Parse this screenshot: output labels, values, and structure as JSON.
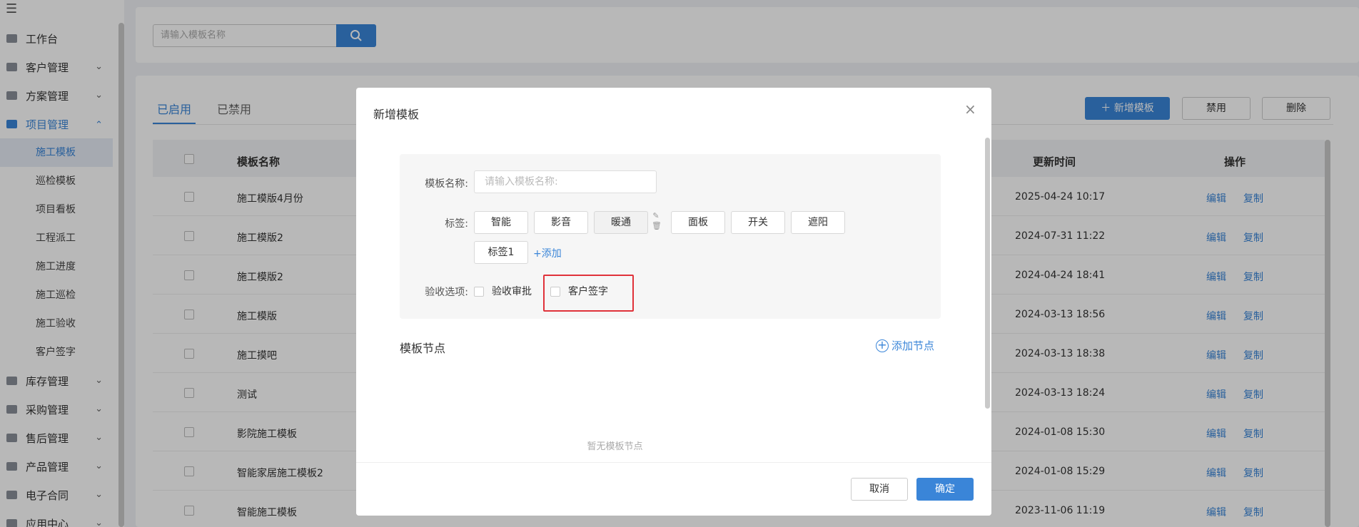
{
  "sidebar": {
    "items": [
      {
        "label": "工作台",
        "icon": "workbench-icon",
        "expandable": false
      },
      {
        "label": "客户管理",
        "icon": "customer-icon",
        "expandable": true
      },
      {
        "label": "方案管理",
        "icon": "plan-icon",
        "expandable": true
      },
      {
        "label": "项目管理",
        "icon": "folder-icon",
        "expandable": true,
        "expanded": true
      },
      {
        "label": "库存管理",
        "icon": "inventory-icon",
        "expandable": true
      },
      {
        "label": "采购管理",
        "icon": "cart-icon",
        "expandable": true
      },
      {
        "label": "售后管理",
        "icon": "headset-icon",
        "expandable": true
      },
      {
        "label": "产品管理",
        "icon": "product-icon",
        "expandable": true
      },
      {
        "label": "电子合同",
        "icon": "contract-icon",
        "expandable": true
      },
      {
        "label": "应用中心",
        "icon": "apps-icon",
        "expandable": true
      }
    ],
    "project_sub": [
      "施工模板",
      "巡检模板",
      "项目看板",
      "工程派工",
      "施工进度",
      "施工巡检",
      "施工验收",
      "客户签字"
    ]
  },
  "search": {
    "placeholder": "请输入模板名称"
  },
  "tabs": [
    "已启用",
    "已禁用"
  ],
  "toolbar": {
    "add_label": "新增模板",
    "disable_label": "禁用",
    "delete_label": "删除"
  },
  "table": {
    "columns": [
      "模板名称",
      "更新时间",
      "操作"
    ],
    "rows": [
      {
        "name": "施工模版4月份",
        "updated": "2025-04-24 10:17"
      },
      {
        "name": "施工模版2",
        "updated": "2024-07-31 11:22"
      },
      {
        "name": "施工模版2",
        "updated": "2024-04-24 18:41"
      },
      {
        "name": "施工模版",
        "updated": "2024-03-13 18:56"
      },
      {
        "name": "施工摸吧",
        "updated": "2024-03-13 18:38"
      },
      {
        "name": "测试",
        "updated": "2024-03-13 18:24"
      },
      {
        "name": "影院施工模板",
        "updated": "2024-01-08 15:30"
      },
      {
        "name": "智能家居施工模板2",
        "updated": "2024-01-08 15:29"
      },
      {
        "name": "智能施工模板",
        "updated": "2023-11-06 11:19"
      }
    ],
    "edit_label": "编辑",
    "copy_label": "复制"
  },
  "modal": {
    "title": "新增模板",
    "name_label": "模板名称:",
    "name_placeholder": "请输入模板名称:",
    "tags_label": "标签:",
    "tags": [
      "智能",
      "影音",
      "暖通",
      "面板",
      "开关",
      "遮阳",
      "标签1"
    ],
    "add_tag_label": "+添加",
    "acceptance_label": "验收选项:",
    "options": [
      "验收审批",
      "客户签字"
    ],
    "nodes_title": "模板节点",
    "add_node_label": "添加节点",
    "empty_text": "暂无模板节点",
    "cancel_label": "取消",
    "confirm_label": "确定"
  },
  "colors": {
    "accent": "#3a85d8",
    "highlight": "#e0323a"
  }
}
